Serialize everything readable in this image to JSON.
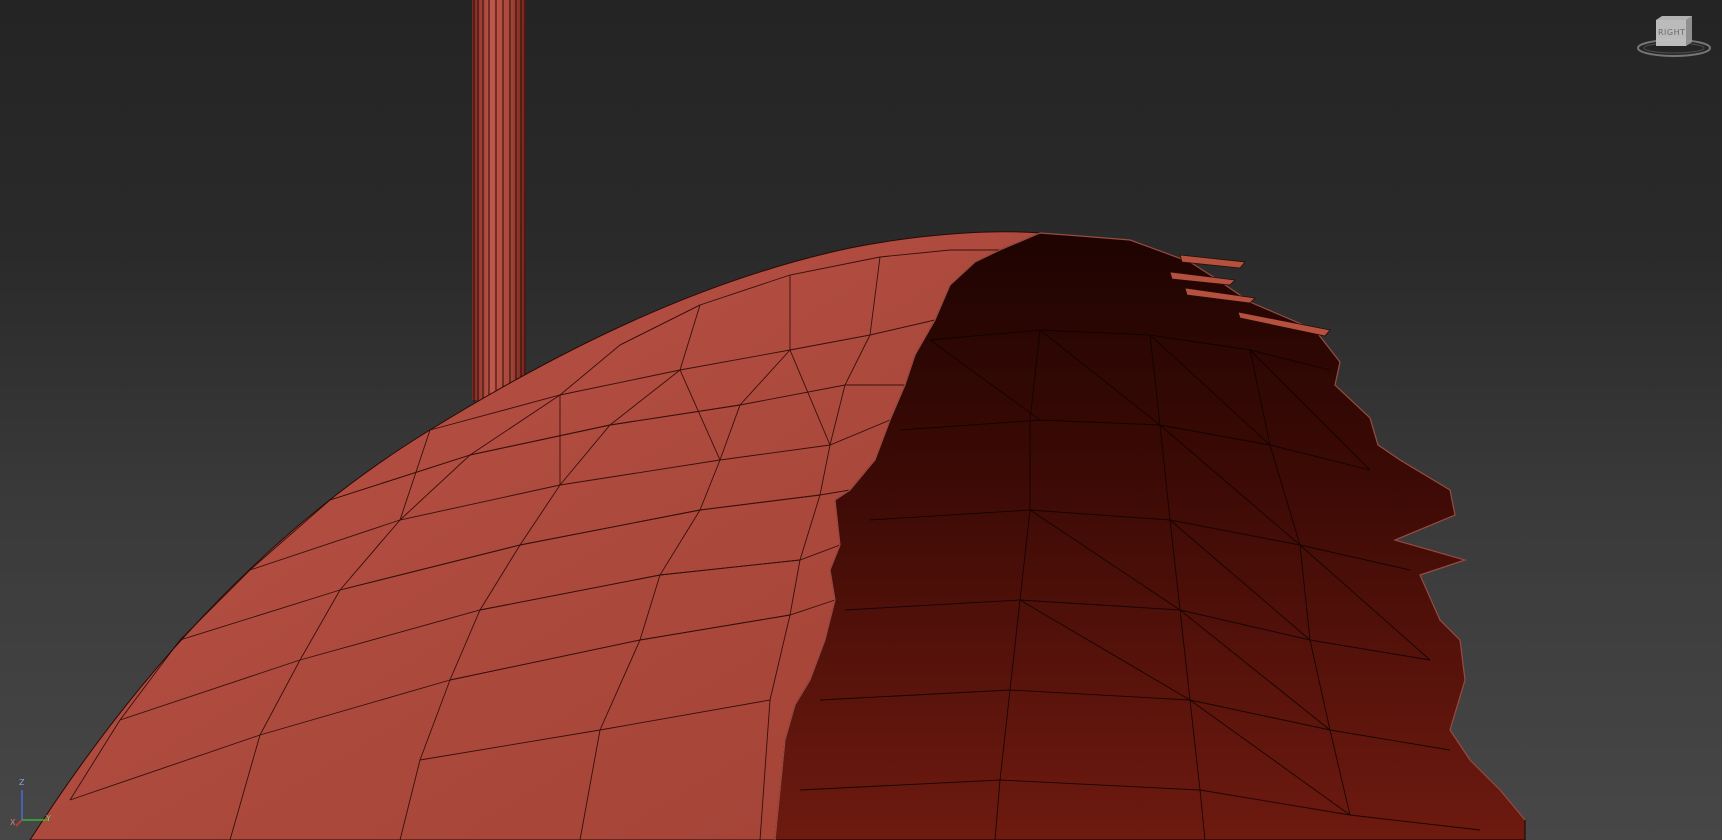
{
  "viewport": {
    "view_mode": "shaded-with-edged-faces",
    "background_top_color": "#242424",
    "background_bottom_color": "#474747",
    "mesh_color": "#b04a3e",
    "mesh_inner_color": "#3a0c07",
    "edge_color": "#1a0604",
    "objects": [
      {
        "name": "cylinder-post",
        "icon": "cylinder-icon"
      },
      {
        "name": "fractured-sphere-shell",
        "icon": "sphere-icon"
      }
    ]
  },
  "viewcube": {
    "face_label": "RIGHT",
    "icon": "viewcube-icon"
  },
  "axis_tripod": {
    "x_label": "X",
    "y_label": "Y",
    "z_label": "Z",
    "x_color": "#d03a3a",
    "y_color": "#3ab03a",
    "z_color": "#4a6ad8"
  }
}
